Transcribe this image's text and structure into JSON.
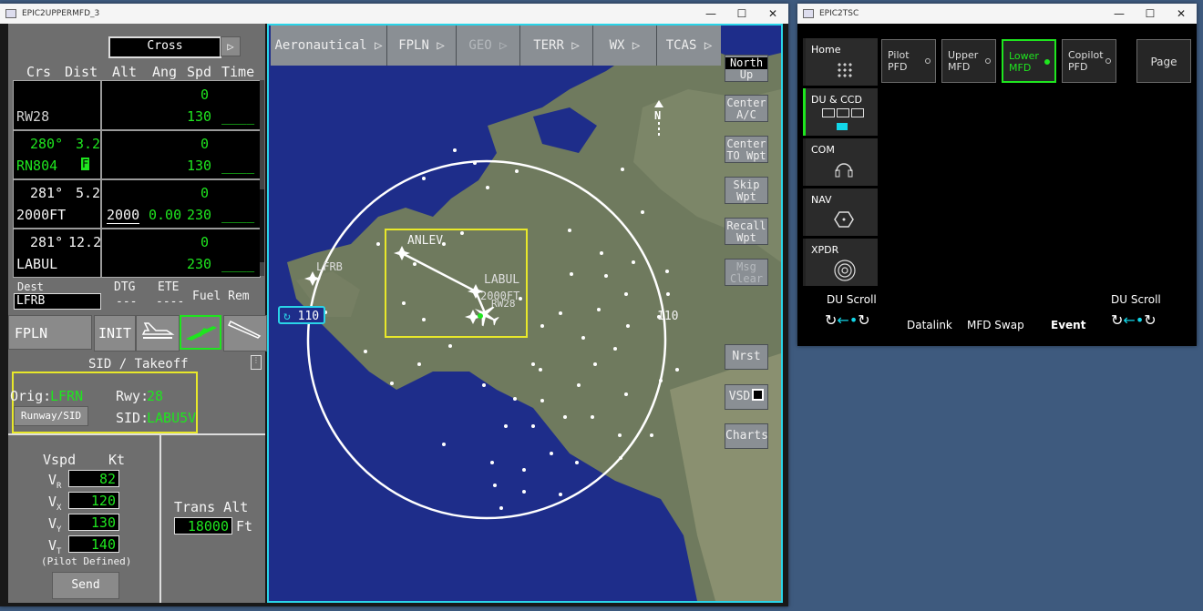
{
  "mfd_window": {
    "title": "EPIC2UPPERMFD_3",
    "controls": {
      "minimize": "—",
      "maximize": "☐",
      "close": "✕"
    }
  },
  "fms": {
    "mode_field": "Cross",
    "mode_arrow": "▷",
    "headers": {
      "crs": "Crs",
      "dist": "Dist",
      "alt": "Alt",
      "ang": "Ang",
      "spd": "Spd",
      "time": "Time"
    },
    "legs": [
      {
        "crs": "",
        "dist": "",
        "wpt": "RW28",
        "flag": "",
        "alt": "",
        "ang": "",
        "spd_top": "0",
        "spd": "130",
        "time": "____"
      },
      {
        "crs": "280°",
        "dist": "3.2",
        "wpt": "RN804",
        "flag": "F",
        "alt": "",
        "ang": "",
        "spd_top": "0",
        "spd": "130",
        "time": "____"
      },
      {
        "crs": "281°",
        "dist": "5.2",
        "wpt": "2000FT",
        "flag": "",
        "alt": "2000",
        "ang": "0.00",
        "spd_top": "0",
        "spd": "230",
        "time": "____"
      },
      {
        "crs": "281°",
        "dist": "12.2",
        "wpt": "LABUL",
        "flag": "",
        "alt": "",
        "ang": "",
        "spd_top": "0",
        "spd": "230",
        "time": "____"
      }
    ],
    "dest_label": "Dest",
    "dest_value": "LFRB",
    "dtg_label": "DTG",
    "dtg_value": "---",
    "ete_label": "ETE",
    "ete_value": "----",
    "fuel_rem_label": "Fuel Rem",
    "buttons": {
      "fpln": "FPLN",
      "init": "INIT"
    },
    "sid": {
      "title": "SID / Takeoff",
      "orig_label": "Orig:",
      "orig_value": "LFRN",
      "rwy_label": "Rwy:",
      "rwy_value": "28",
      "runway_sid_btn": "Runway/SID",
      "sid_label": "SID:",
      "sid_value": "LABU5V"
    },
    "vspeeds": {
      "vspd_label": "Vspd",
      "kt_label": "Kt",
      "vr_label": "V",
      "vr_sub": "R",
      "vr": "82",
      "vx_label": "V",
      "vx_sub": "X",
      "vx": "120",
      "vy_label": "V",
      "vy_sub": "Y",
      "vy": "130",
      "vt_label": "V",
      "vt_sub": "T",
      "vt": "140",
      "pilot_defined": "(Pilot Defined)",
      "send": "Send"
    },
    "trans_alt_label": "Trans Alt",
    "trans_alt_value": "18000",
    "trans_alt_unit": "Ft"
  },
  "map": {
    "tabs": [
      "Aeronautical",
      "FPLN",
      "GEO",
      "TERR",
      "WX",
      "TCAS"
    ],
    "tab_arrow": "▷",
    "north_up_line1": "North",
    "north_up_line2": "Up",
    "side_buttons": [
      {
        "l1": "Center",
        "l2": "A/C"
      },
      {
        "l1": "Center",
        "l2": "TO Wpt"
      },
      {
        "l1": "Skip",
        "l2": "Wpt"
      },
      {
        "l1": "Recall",
        "l2": "Wpt"
      },
      {
        "l1": "Msg",
        "l2": "Clear"
      }
    ],
    "nrst": "Nrst",
    "vsd": "VSD",
    "charts": "Charts",
    "north_label": "N",
    "range_left": "110",
    "range_right": "110",
    "waypoints": {
      "anlev": "ANLEV",
      "labul": "LABUL",
      "alt_tag": "2000FT",
      "lfrb": "LFRB",
      "rw28": "RW28"
    }
  },
  "tsc_window": {
    "title": "EPIC2TSC",
    "controls": {
      "minimize": "—",
      "maximize": "☐",
      "close": "✕"
    },
    "side": [
      "Home",
      "DU & CCD",
      "COM",
      "NAV",
      "XPDR"
    ],
    "top_buttons": [
      {
        "l1": "Pilot",
        "l2": "PFD"
      },
      {
        "l1": "Upper",
        "l2": "MFD"
      },
      {
        "l1": "Lower",
        "l2": "MFD"
      },
      {
        "l1": "Copilot",
        "l2": "PFD"
      }
    ],
    "page": "Page",
    "du_scroll_left": "DU Scroll",
    "du_scroll_right": "DU Scroll",
    "datalink": "Datalink",
    "mfd_swap": "MFD Swap",
    "event": "Event"
  },
  "colors": {
    "accent_green": "#1fe51f",
    "map_border": "#2ad4e8",
    "highlight_yellow": "#e8e82a",
    "selected_cyan": "#12d6e8"
  }
}
